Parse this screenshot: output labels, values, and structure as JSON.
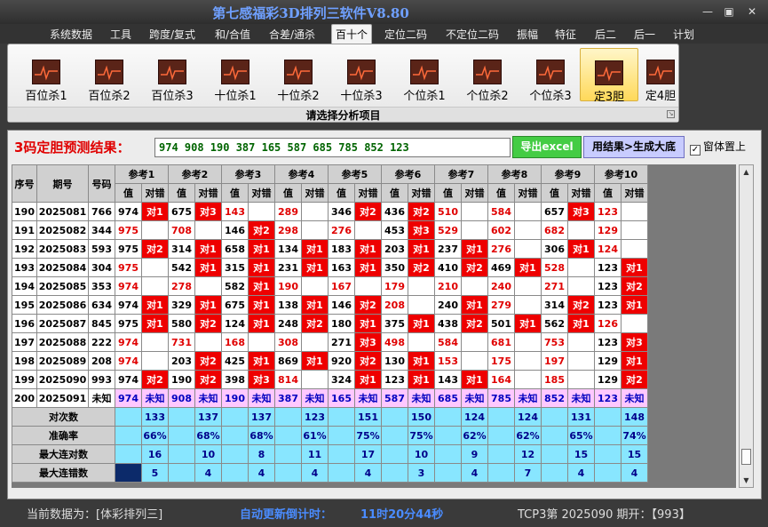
{
  "app": {
    "title": "第七感福彩3D排列三软件V8.80",
    "minimize": "—",
    "restore": "▣",
    "close": "✕"
  },
  "menu": [
    "系统数据",
    "工具",
    "跨度/复式",
    "和/合值",
    "合差/通杀",
    "百十个",
    "定位二码",
    "不定位二码",
    "振幅",
    "特征",
    "后二",
    "后一",
    "计划"
  ],
  "ribbon": {
    "buttons": [
      {
        "label": "百位杀1",
        "selected": false
      },
      {
        "label": "百位杀2",
        "selected": false
      },
      {
        "label": "百位杀3",
        "selected": false
      },
      {
        "label": "十位杀1",
        "selected": false
      },
      {
        "label": "十位杀2",
        "selected": false
      },
      {
        "label": "十位杀3",
        "selected": false
      },
      {
        "label": "个位杀1",
        "selected": false
      },
      {
        "label": "个位杀2",
        "selected": false
      },
      {
        "label": "个位杀3",
        "selected": false
      },
      {
        "label": "定3胆",
        "selected": true
      },
      {
        "label": "定4胆",
        "selected": false
      }
    ],
    "caption": "请选择分析项目",
    "icon": "chart-line-icon"
  },
  "result": {
    "label": "3码定胆预测结果：",
    "value": "974 908 190 387 165 587 685 785 852 123",
    "export": "导出excel",
    "generate": "用结果>生成大底",
    "topmost": "窗体置上",
    "topmost_checked": "✓"
  },
  "colors": {
    "hit": "#ee0000",
    "predict": "#ffc8ff",
    "stats": "#88e6ff",
    "accent": "#6fa0ff"
  },
  "table": {
    "headers": {
      "seq": "序号",
      "period": "期号",
      "code": "号码",
      "value": "值",
      "judge": "对错"
    },
    "refs": [
      "参考1",
      "参考2",
      "参考3",
      "参考4",
      "参考5",
      "参考6",
      "参考7",
      "参考8",
      "参考9",
      "参考10"
    ],
    "rows": [
      {
        "seq": "190",
        "period": "2025081",
        "code": "766",
        "refs": [
          [
            "974",
            "对1"
          ],
          [
            "675",
            "对3"
          ],
          [
            "143",
            ""
          ],
          [
            "289",
            ""
          ],
          [
            "346",
            "对2"
          ],
          [
            "436",
            "对2"
          ],
          [
            "510",
            ""
          ],
          [
            "584",
            ""
          ],
          [
            "657",
            "对3"
          ],
          [
            "123",
            ""
          ]
        ]
      },
      {
        "seq": "191",
        "period": "2025082",
        "code": "344",
        "refs": [
          [
            "975",
            ""
          ],
          [
            "708",
            ""
          ],
          [
            "146",
            "对2"
          ],
          [
            "298",
            ""
          ],
          [
            "276",
            ""
          ],
          [
            "453",
            "对3"
          ],
          [
            "529",
            ""
          ],
          [
            "602",
            ""
          ],
          [
            "682",
            ""
          ],
          [
            "129",
            ""
          ]
        ]
      },
      {
        "seq": "192",
        "period": "2025083",
        "code": "593",
        "refs": [
          [
            "975",
            "对2"
          ],
          [
            "314",
            "对1"
          ],
          [
            "658",
            "对1"
          ],
          [
            "134",
            "对1"
          ],
          [
            "183",
            "对1"
          ],
          [
            "203",
            "对1"
          ],
          [
            "237",
            "对1"
          ],
          [
            "276",
            ""
          ],
          [
            "306",
            "对1"
          ],
          [
            "124",
            ""
          ]
        ]
      },
      {
        "seq": "193",
        "period": "2025084",
        "code": "304",
        "refs": [
          [
            "975",
            ""
          ],
          [
            "542",
            "对1"
          ],
          [
            "315",
            "对1"
          ],
          [
            "231",
            "对1"
          ],
          [
            "163",
            "对1"
          ],
          [
            "350",
            "对2"
          ],
          [
            "410",
            "对2"
          ],
          [
            "469",
            "对1"
          ],
          [
            "528",
            ""
          ],
          [
            "123",
            "对1"
          ]
        ]
      },
      {
        "seq": "194",
        "period": "2025085",
        "code": "353",
        "refs": [
          [
            "974",
            ""
          ],
          [
            "278",
            ""
          ],
          [
            "582",
            "对1"
          ],
          [
            "190",
            ""
          ],
          [
            "167",
            ""
          ],
          [
            "179",
            ""
          ],
          [
            "210",
            ""
          ],
          [
            "240",
            ""
          ],
          [
            "271",
            ""
          ],
          [
            "123",
            "对2"
          ]
        ]
      },
      {
        "seq": "195",
        "period": "2025086",
        "code": "634",
        "refs": [
          [
            "974",
            "对1"
          ],
          [
            "329",
            "对1"
          ],
          [
            "675",
            "对1"
          ],
          [
            "138",
            "对1"
          ],
          [
            "146",
            "对2"
          ],
          [
            "208",
            ""
          ],
          [
            "240",
            "对1"
          ],
          [
            "279",
            ""
          ],
          [
            "314",
            "对2"
          ],
          [
            "123",
            "对1"
          ]
        ]
      },
      {
        "seq": "196",
        "period": "2025087",
        "code": "845",
        "refs": [
          [
            "975",
            "对1"
          ],
          [
            "580",
            "对2"
          ],
          [
            "124",
            "对1"
          ],
          [
            "248",
            "对2"
          ],
          [
            "180",
            "对1"
          ],
          [
            "375",
            "对1"
          ],
          [
            "438",
            "对2"
          ],
          [
            "501",
            "对1"
          ],
          [
            "562",
            "对1"
          ],
          [
            "126",
            ""
          ]
        ]
      },
      {
        "seq": "197",
        "period": "2025088",
        "code": "222",
        "refs": [
          [
            "974",
            ""
          ],
          [
            "731",
            ""
          ],
          [
            "168",
            ""
          ],
          [
            "308",
            ""
          ],
          [
            "271",
            "对3"
          ],
          [
            "498",
            ""
          ],
          [
            "584",
            ""
          ],
          [
            "681",
            ""
          ],
          [
            "753",
            ""
          ],
          [
            "123",
            "对3"
          ]
        ]
      },
      {
        "seq": "198",
        "period": "2025089",
        "code": "208",
        "refs": [
          [
            "974",
            ""
          ],
          [
            "203",
            "对2"
          ],
          [
            "425",
            "对1"
          ],
          [
            "869",
            "对1"
          ],
          [
            "920",
            "对2"
          ],
          [
            "130",
            "对1"
          ],
          [
            "153",
            ""
          ],
          [
            "175",
            ""
          ],
          [
            "197",
            ""
          ],
          [
            "129",
            "对1"
          ]
        ]
      },
      {
        "seq": "199",
        "period": "2025090",
        "code": "993",
        "refs": [
          [
            "974",
            "对2"
          ],
          [
            "190",
            "对2"
          ],
          [
            "398",
            "对3"
          ],
          [
            "814",
            ""
          ],
          [
            "324",
            "对1"
          ],
          [
            "123",
            "对1"
          ],
          [
            "143",
            "对1"
          ],
          [
            "164",
            ""
          ],
          [
            "185",
            ""
          ],
          [
            "129",
            "对2"
          ]
        ]
      }
    ],
    "predict_row": {
      "seq": "200",
      "period": "2025091",
      "code": "未知",
      "values": [
        "974",
        "908",
        "190",
        "387",
        "165",
        "587",
        "685",
        "785",
        "852",
        "123"
      ],
      "unknown": "未知"
    },
    "stats": [
      {
        "label": "对次数",
        "values": [
          "133",
          "137",
          "137",
          "123",
          "151",
          "150",
          "124",
          "124",
          "131",
          "148"
        ]
      },
      {
        "label": "准确率",
        "values": [
          "66%",
          "68%",
          "68%",
          "61%",
          "75%",
          "75%",
          "62%",
          "62%",
          "65%",
          "74%"
        ]
      },
      {
        "label": "最大连对数",
        "values": [
          "16",
          "10",
          "8",
          "11",
          "17",
          "10",
          "9",
          "12",
          "15",
          "15"
        ]
      },
      {
        "label": "最大连错数",
        "values": [
          "5",
          "4",
          "4",
          "4",
          "4",
          "3",
          "4",
          "7",
          "4",
          "4"
        ]
      }
    ]
  },
  "status": {
    "current": "当前数据为：[体彩排列三]",
    "countdown_label": "自动更新倒计时：",
    "countdown_value": "11时20分44秒",
    "issue": "TCP3第 2025090 期开：【993】"
  }
}
